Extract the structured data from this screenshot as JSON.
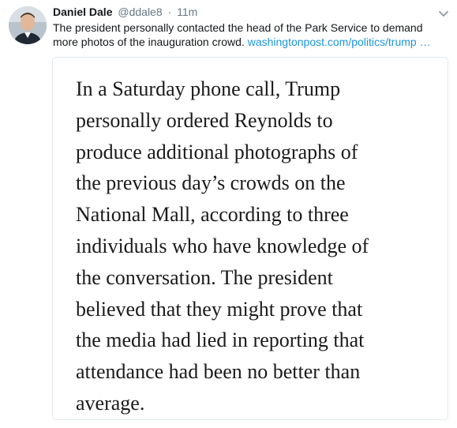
{
  "tweet": {
    "author_name": "Daniel Dale",
    "author_handle": "@ddale8",
    "separator": "·",
    "timestamp": "11m",
    "avatar_icon": "avatar-photo",
    "caret_icon": "chevron-down-icon",
    "text_line_1": "The president personally contacted the head of the Park Service to demand",
    "text_line_2_prefix": "more photos of the inauguration crowd. ",
    "link_text": "washingtonpost.com/politics/trump …",
    "link_color": "#1b95e0"
  },
  "quote": {
    "lines": [
      "In a Saturday phone call, Trump",
      "personally ordered Reynolds to",
      "produce additional photographs of",
      "the previous day’s crowds on the",
      "National Mall, according to three",
      "individuals who have knowledge of",
      "the conversation. The president",
      "believed that they might prove that",
      "the media had lied in reporting that",
      "attendance had been no better than",
      "average."
    ]
  }
}
